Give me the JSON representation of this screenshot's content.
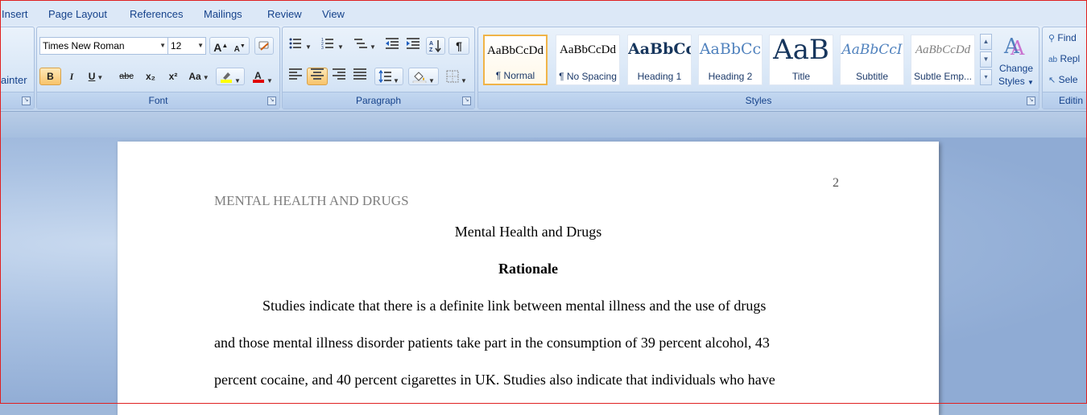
{
  "tabs": [
    "Insert",
    "Page Layout",
    "References",
    "Mailings",
    "Review",
    "View"
  ],
  "clipboard": {
    "format_painter_label": "ainter"
  },
  "font": {
    "name": "Times New Roman",
    "size": "12",
    "group_label": "Font",
    "grow_glyph": "A",
    "shrink_glyph": "A",
    "bold": "B",
    "italic": "I",
    "underline": "U",
    "strike": "abc",
    "subscript": "x₂",
    "superscript": "x²",
    "change_case": "Aa",
    "highlight_color": "#ffff00",
    "font_color": "#e00000"
  },
  "paragraph": {
    "group_label": "Paragraph",
    "show_marks": "¶"
  },
  "styles": {
    "group_label": "Styles",
    "items": [
      {
        "sample": "AaBbCcDd",
        "name": "¶ Normal"
      },
      {
        "sample": "AaBbCcDd",
        "name": "¶ No Spacing"
      },
      {
        "sample": "AaBbCc",
        "name": "Heading 1"
      },
      {
        "sample": "AaBbCc",
        "name": "Heading 2"
      },
      {
        "sample": "AaB",
        "name": "Title"
      },
      {
        "sample": "AaBbCcI",
        "name": "Subtitle"
      },
      {
        "sample": "AaBbCcDd",
        "name": "Subtle Emp..."
      }
    ],
    "change_styles_line1": "Change",
    "change_styles_line2": "Styles"
  },
  "editing": {
    "group_label": "Editin",
    "find": "Find",
    "replace": "Repl",
    "select": "Sele"
  },
  "document": {
    "page_number": "2",
    "running_head": "MENTAL HEALTH AND DRUGS",
    "title": "Mental Health and Drugs",
    "heading": "Rationale",
    "lines": [
      "Studies indicate that there is a definite link between mental illness and the use of drugs",
      "and those mental illness disorder patients take part in the consumption of 39 percent alcohol, 43",
      "percent cocaine, and 40 percent cigarettes in UK.  Studies also indicate that individuals who have"
    ]
  }
}
